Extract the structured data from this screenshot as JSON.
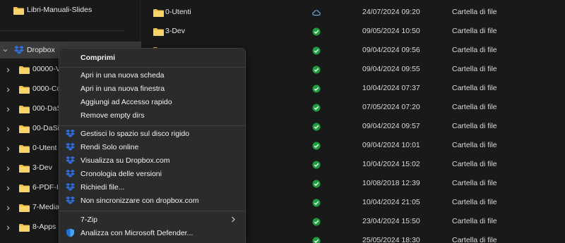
{
  "nav": {
    "top_item": "Libri-Manuali-Slides",
    "root": "Dropbox",
    "children": [
      "00000-V",
      "0000-Co",
      "000-DaS",
      "00-DaSi",
      "0-Utent",
      "3-Dev",
      "6-PDF-I",
      "7-Media",
      "8-Apps"
    ]
  },
  "files": [
    {
      "name": "0-Utenti",
      "status": "cloud",
      "date": "24/07/2024 09:20",
      "type": "Cartella di file"
    },
    {
      "name": "3-Dev",
      "status": "synced",
      "date": "09/05/2024 10:50",
      "type": "Cartella di file"
    },
    {
      "name": "",
      "status": "synced",
      "date": "09/04/2024 09:56",
      "type": "Cartella di file"
    },
    {
      "name": "",
      "status": "synced",
      "date": "09/04/2024 09:55",
      "type": "Cartella di file"
    },
    {
      "name": "",
      "status": "synced",
      "date": "10/04/2024 07:37",
      "type": "Cartella di file"
    },
    {
      "name": "",
      "status": "synced",
      "date": "07/05/2024 07:20",
      "type": "Cartella di file"
    },
    {
      "name": "",
      "status": "synced",
      "date": "09/04/2024 09:57",
      "type": "Cartella di file"
    },
    {
      "name": "",
      "status": "synced",
      "date": "09/04/2024 10:01",
      "type": "Cartella di file"
    },
    {
      "name": "",
      "status": "synced",
      "date": "10/04/2024 15:02",
      "type": "Cartella di file"
    },
    {
      "name": "",
      "status": "synced",
      "date": "10/08/2018 12:39",
      "type": "Cartella di file"
    },
    {
      "name": "",
      "status": "synced",
      "date": "10/04/2024 21:05",
      "type": "Cartella di file"
    },
    {
      "name": "",
      "status": "synced",
      "date": "23/04/2024 15:50",
      "type": "Cartella di file"
    },
    {
      "name": "",
      "status": "synced",
      "date": "25/05/2024 18:30",
      "type": "Cartella di file"
    }
  ],
  "context_menu": {
    "compress": "Comprimi",
    "open_new_tab": "Apri in una nuova scheda",
    "open_new_window": "Apri in una nuova finestra",
    "add_quick_access": "Aggiungi ad Accesso rapido",
    "remove_empty_dirs": "Remove empty dirs",
    "dropbox_manage_space": "Gestisci lo spazio sul disco rigido",
    "dropbox_online_only": "Rendi Solo online",
    "dropbox_view_web": "Visualizza su Dropbox.com",
    "dropbox_version_history": "Cronologia delle versioni",
    "dropbox_request_files": "Richiedi file...",
    "dropbox_dont_sync": "Non sincronizzare con dropbox.com",
    "sevenzip": "7-Zip",
    "defender_scan": "Analizza con Microsoft Defender..."
  },
  "colors": {
    "background": "#191919",
    "menu_bg": "#2b2b2b",
    "folder": "#f0c24b",
    "dropbox": "#2f6fe4",
    "synced": "#1f9e3f",
    "cloud": "#6aa6e0"
  }
}
